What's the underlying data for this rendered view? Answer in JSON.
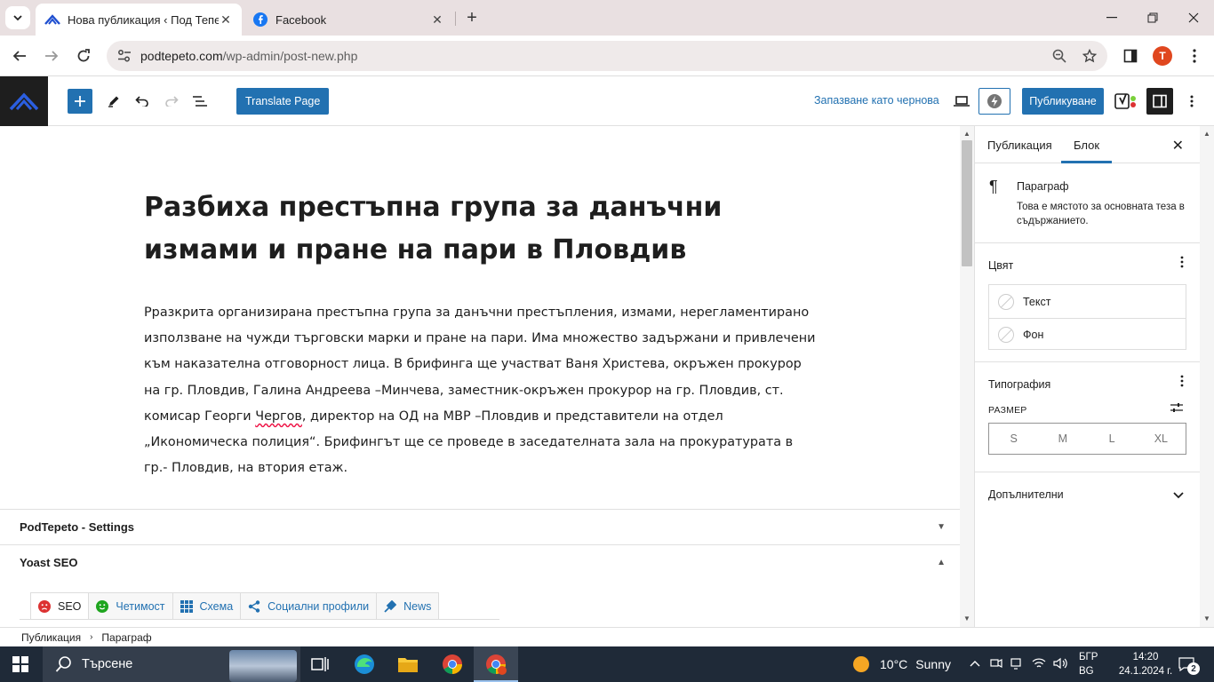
{
  "browser": {
    "tabs": [
      {
        "title": "Нова публикация ‹ Под Тепето",
        "active": true
      },
      {
        "title": "Facebook",
        "active": false
      }
    ],
    "url_host": "podtepeto.com",
    "url_path": "/wp-admin/post-new.php",
    "profile_initial": "T"
  },
  "editor_toolbar": {
    "translate_label": "Translate Page",
    "save_draft_label": "Запазване като чернова",
    "publish_label": "Публикуване"
  },
  "post": {
    "title": "Разбиха престъпна група за данъчни измами и пране на пари в Пловдив",
    "body_before": "Рразкрита организирана престъпна група за данъчни престъпления, измами, нерегламентирано използване на чужди търговски марки и пране на пари. Има множество задържани и привлечени към наказателна отговорност лица.  В  брифинга ще участват Ваня Христева, окръжен прокурор на гр. Пловдив, Галина Андреева –Минчева, заместник-окръжен прокурор на гр. Пловдив, ст. комисар Георги ",
    "body_misspelled": "Чергов",
    "body_after": ", директор на ОД на МВР –Пловдив и представители на отдел „Икономическа полиция“.  Брифингът ще се проведе в заседателната зала на прокуратурата в гр.- Пловдив, на втория етаж."
  },
  "metaboxes": {
    "settings_title": "PodTepeto - Settings",
    "yoast_title": "Yoast SEO",
    "yoast_tabs": [
      {
        "label": "SEO",
        "icon": "sad-face-icon"
      },
      {
        "label": "Четимост",
        "icon": "smile-face-icon"
      },
      {
        "label": "Схема",
        "icon": "grid-icon"
      },
      {
        "label": "Социални профили",
        "icon": "share-icon"
      },
      {
        "label": "News",
        "icon": "news-icon"
      }
    ]
  },
  "breadcrumbs": [
    "Публикация",
    "Параграф"
  ],
  "sidebar": {
    "tabs": [
      "Публикация",
      "Блок"
    ],
    "active_tab": "Блок",
    "block_name": "Параграф",
    "block_desc": "Това е мястото за основната теза в съдържанието.",
    "color_title": "Цвят",
    "color_text": "Текст",
    "color_bg": "Фон",
    "typography_title": "Типография",
    "size_label": "РАЗМЕР",
    "sizes": [
      "S",
      "M",
      "L",
      "XL"
    ],
    "advanced_title": "Допълнителни"
  },
  "taskbar": {
    "search_placeholder": "Търсене",
    "temperature": "10°C",
    "weather": "Sunny",
    "lang_1": "БГР",
    "lang_2": "BG",
    "time": "14:20",
    "date": "24.1.2024 г.",
    "notification_count": "2"
  },
  "colors": {
    "wp_blue": "#2271b1",
    "chrome_tabbar": "#e9e0e1",
    "taskbar": "#1f2a38"
  }
}
